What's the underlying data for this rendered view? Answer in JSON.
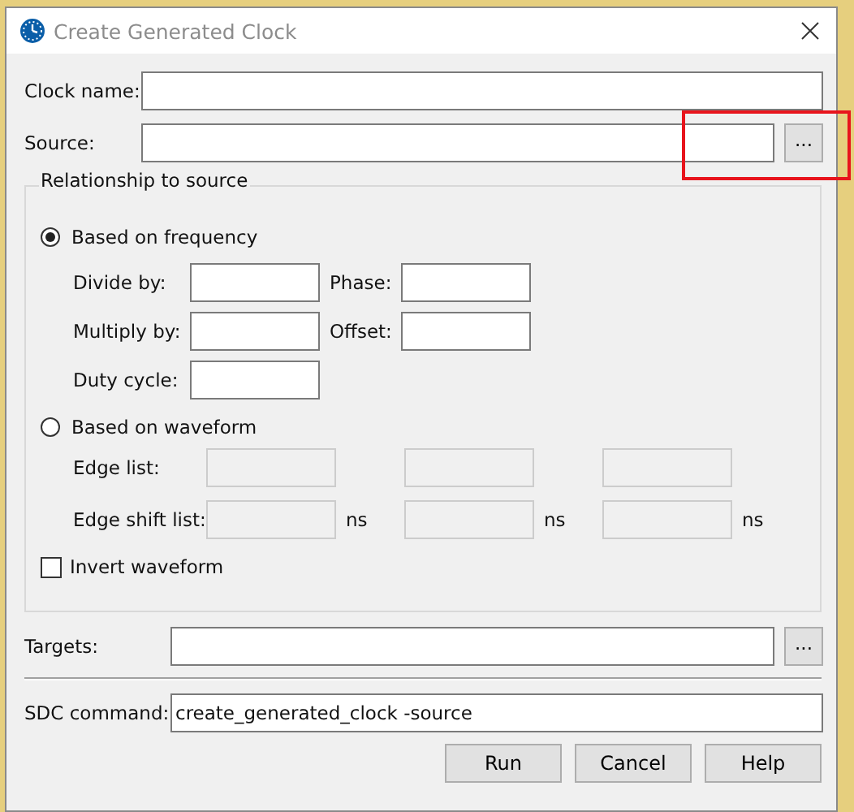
{
  "window": {
    "title": "Create Generated Clock"
  },
  "clock_name": {
    "label": "Clock name:"
  },
  "source": {
    "label": "Source:",
    "browse": "..."
  },
  "relationship": {
    "title": "Relationship to source",
    "modes": [
      {
        "label": "Based on frequency",
        "selected": true
      },
      {
        "label": "Based on waveform",
        "selected": false
      }
    ],
    "frequency_fields": [
      {
        "label": "Divide by:"
      },
      {
        "label": "Phase:"
      },
      {
        "label": "Multiply by:"
      },
      {
        "label": "Offset:"
      },
      {
        "label": "Duty cycle:"
      }
    ],
    "edge_list": {
      "label": "Edge list:",
      "disabled": true
    },
    "edge_shift_list": {
      "label": "Edge shift list:",
      "disabled": true,
      "units": [
        "ns",
        "ns",
        "ns"
      ]
    },
    "invert_waveform": {
      "label": "Invert waveform",
      "checked": false
    }
  },
  "targets": {
    "label": "Targets:",
    "browse": "..."
  },
  "sdc_command": {
    "label": "SDC command:",
    "value": "create_generated_clock -source"
  },
  "buttons": [
    "Run",
    "Cancel",
    "Help"
  ]
}
